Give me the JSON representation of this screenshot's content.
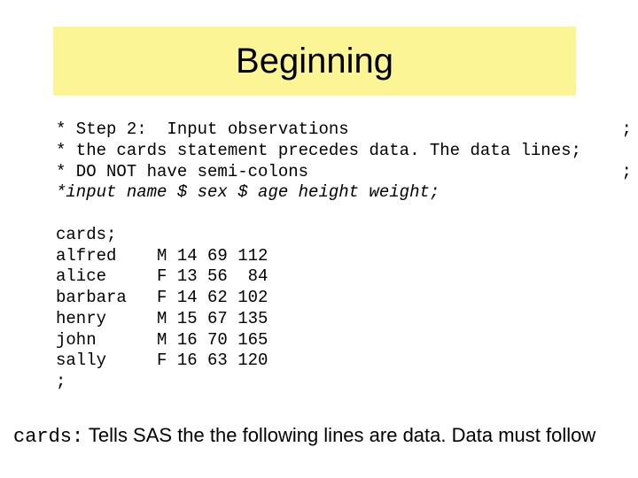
{
  "title": "Beginning",
  "code": {
    "line1": "* Step 2:  Input observations                           ;",
    "line2": "* the cards statement precedes data. The data lines;",
    "line3": "* DO NOT have semi-colons                               ;",
    "line4_italic": "*input name $ sex $ age height weight;",
    "blank": "",
    "cards": "cards;",
    "row1": "alfred    M 14 69 112",
    "row2": "alice     F 13 56  84",
    "row3": "barbara   F 14 62 102",
    "row4": "henry     M 15 67 135",
    "row5": "john      M 16 70 165",
    "row6": "sally     F 16 63 120",
    "semi": ";"
  },
  "footer": {
    "keyword": "cards:",
    "text": " Tells SAS the the following lines are data.  Data must follow"
  },
  "chart_data": {
    "type": "table",
    "title": "SAS cards data",
    "columns": [
      "name",
      "sex",
      "age",
      "height",
      "weight"
    ],
    "rows": [
      [
        "alfred",
        "M",
        14,
        69,
        112
      ],
      [
        "alice",
        "F",
        13,
        56,
        84
      ],
      [
        "barbara",
        "F",
        14,
        62,
        102
      ],
      [
        "henry",
        "M",
        15,
        67,
        135
      ],
      [
        "john",
        "M",
        16,
        70,
        165
      ],
      [
        "sally",
        "F",
        16,
        63,
        120
      ]
    ]
  }
}
